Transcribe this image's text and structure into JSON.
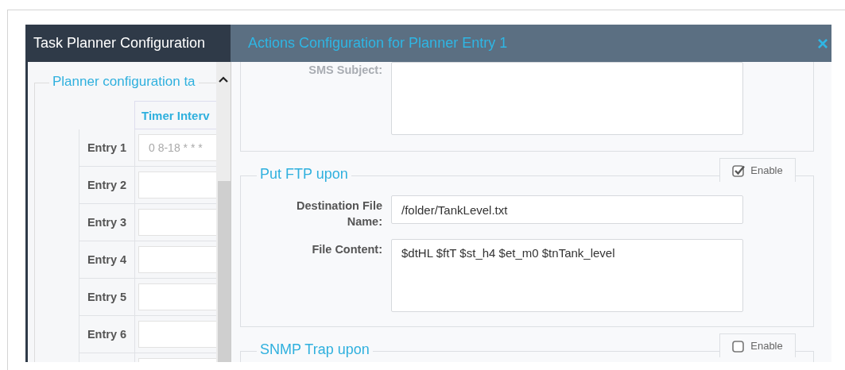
{
  "background_window": {
    "title": "Task Planner Configuration",
    "fieldset_legend": "Planner configuration ta",
    "table": {
      "columns": [
        "Timer Interv"
      ],
      "rows": [
        {
          "label": "Entry 1",
          "placeholder": "0 8-18 * * *"
        },
        {
          "label": "Entry 2"
        },
        {
          "label": "Entry 3"
        },
        {
          "label": "Entry 4"
        },
        {
          "label": "Entry 5"
        },
        {
          "label": "Entry 6"
        },
        {}
      ]
    }
  },
  "dialog": {
    "title": "Actions Configuration for Planner Entry 1",
    "close": "×",
    "sections": [
      {
        "fields": [
          {
            "label": "SMS Subject:",
            "multiline": true,
            "muted": true
          }
        ]
      },
      {
        "legend": "Put FTP upon",
        "enable": {
          "label": "Enable",
          "checked": true
        },
        "fields": [
          {
            "label": "Destination File Name:",
            "value": "/folder/TankLevel.txt",
            "multiline": false,
            "muted": false
          },
          {
            "label": "File Content:",
            "value": "$dtHL $ftT $st_h4 $et_m0 $tnTank_level",
            "multiline": true,
            "muted": false
          }
        ]
      },
      {
        "legend": "SNMP Trap upon",
        "enable": {
          "label": "Enable",
          "checked": false
        }
      }
    ]
  }
}
